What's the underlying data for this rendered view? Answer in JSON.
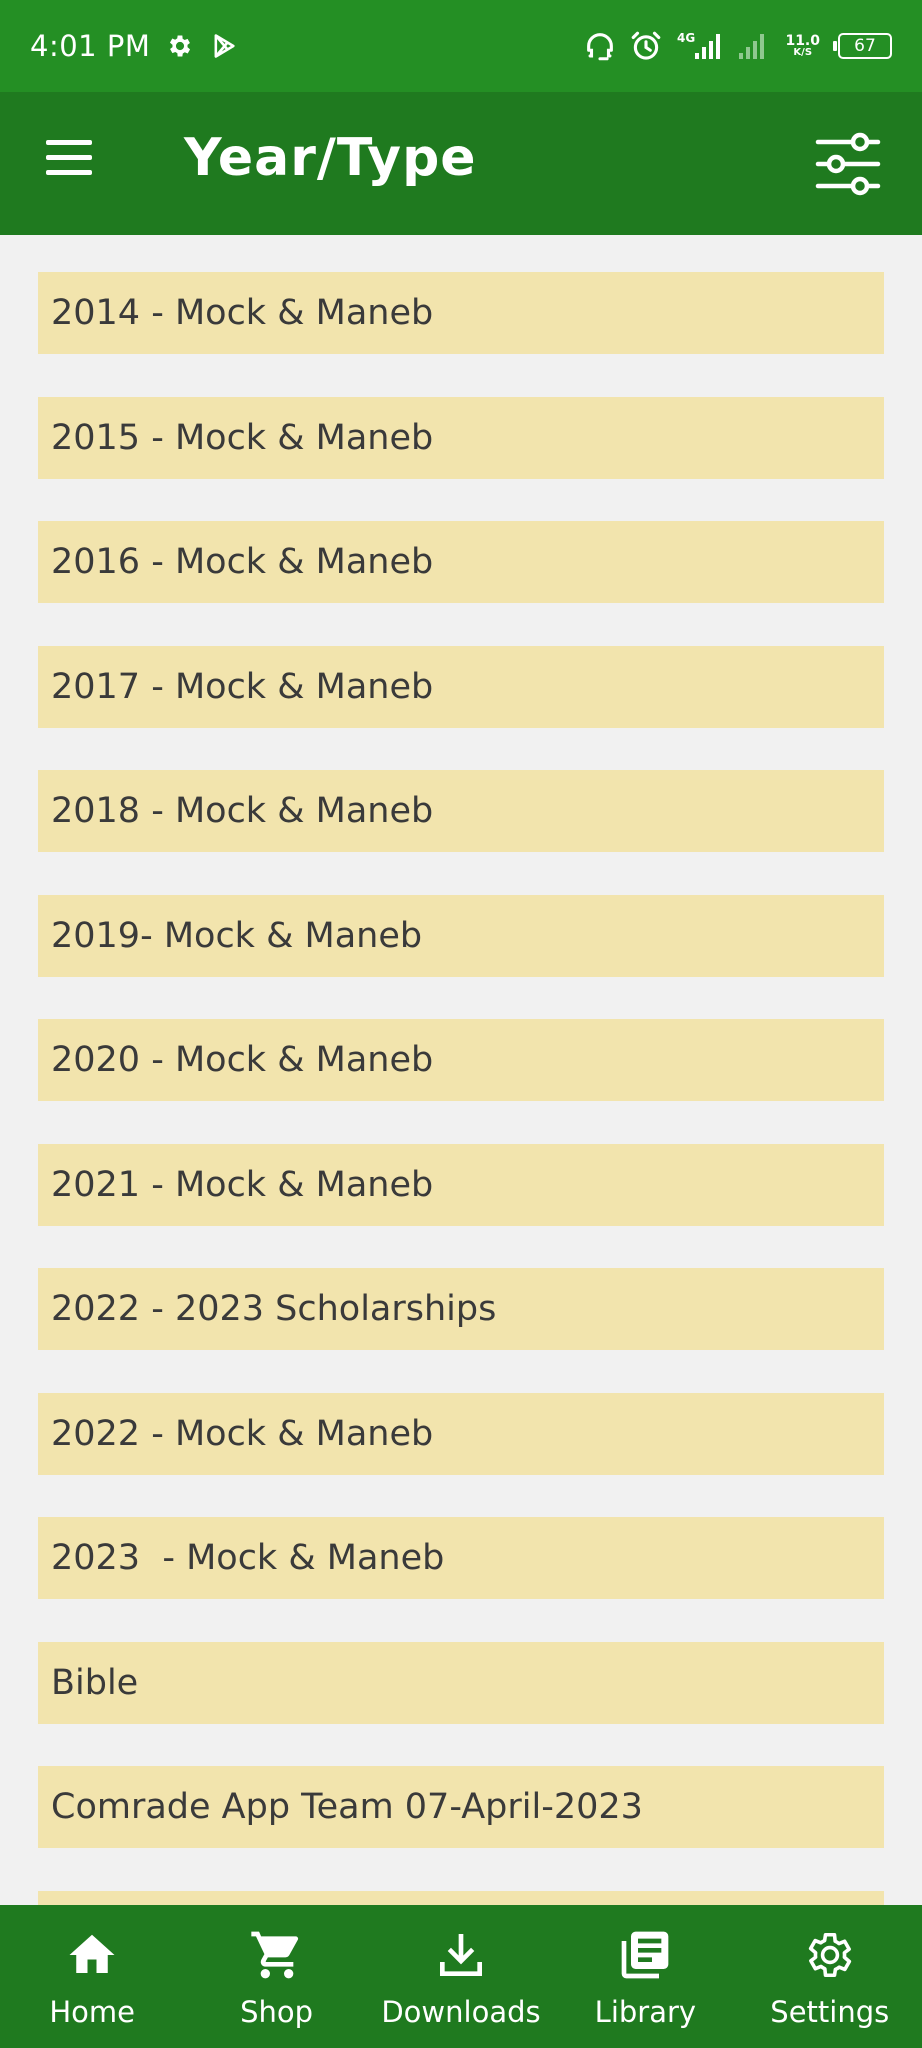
{
  "status_bar": {
    "time": "4:01 PM",
    "icons": [
      "gear-icon",
      "play-store-icon",
      "headset-icon",
      "alarm-icon",
      "signal-4g-icon",
      "signal-icon"
    ],
    "network_type": "4G",
    "net_speed": "11.0",
    "net_unit": "K/S",
    "battery": "67"
  },
  "app_bar": {
    "title": "Year/Type",
    "menu_icon": "hamburger-icon",
    "filter_icon": "sliders-icon"
  },
  "list": {
    "items": [
      "2014 - Mock & Maneb",
      "2015 - Mock & Maneb",
      "2016 - Mock & Maneb",
      "2017 - Mock & Maneb",
      "2018 - Mock & Maneb",
      "2019- Mock & Maneb",
      "2020 - Mock & Maneb",
      "2021 - Mock & Maneb",
      "2022 - 2023 Scholarships",
      "2022 - Mock & Maneb",
      "2023  - Mock & Maneb",
      "Bible",
      "Comrade App Team 07-April-2023",
      ""
    ]
  },
  "bottom_nav": {
    "items": [
      {
        "label": "Home",
        "icon": "home-icon"
      },
      {
        "label": "Shop",
        "icon": "cart-icon"
      },
      {
        "label": "Downloads",
        "icon": "download-icon"
      },
      {
        "label": "Library",
        "icon": "library-icon"
      },
      {
        "label": "Settings",
        "icon": "gear-icon"
      }
    ]
  },
  "colors": {
    "status_bar": "#248f24",
    "app_bar": "#1f7a1f",
    "list_item_bg": "#f2e4ad",
    "background": "#f1f1f1"
  }
}
